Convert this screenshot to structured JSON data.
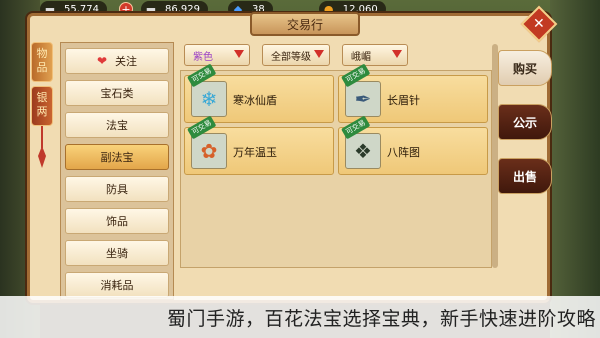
{
  "resources": [
    {
      "icon": "silver-ingot-icon",
      "glyph": "▬",
      "value": "55,774",
      "color": "#d9d9d9"
    },
    {
      "icon": "silver-ingot-icon",
      "glyph": "▬",
      "value": "86,929",
      "color": "#d9d9d9"
    },
    {
      "icon": "diamond-icon",
      "glyph": "◆",
      "value": "38",
      "color": "#4a9cff"
    },
    {
      "icon": "gold-ingot-icon",
      "glyph": "●",
      "value": "12,060",
      "color": "#f0a020"
    }
  ],
  "plus_label": "+",
  "title": "交易行",
  "close_label": "✕",
  "left_tabs": [
    {
      "label": "物品"
    },
    {
      "label": "银两"
    }
  ],
  "categories": [
    {
      "label": "关注"
    },
    {
      "label": "宝石类"
    },
    {
      "label": "法宝"
    },
    {
      "label": "副法宝"
    },
    {
      "label": "防具"
    },
    {
      "label": "饰品"
    },
    {
      "label": "坐骑"
    },
    {
      "label": "消耗品"
    }
  ],
  "filters": {
    "color": "紫色",
    "level": "全部等级",
    "type": "峨嵋"
  },
  "items": [
    {
      "name": "寒冰仙盾",
      "badge": "可交易",
      "icon": "ice-crystal-icon",
      "glyph": "❄"
    },
    {
      "name": "长眉针",
      "badge": "可交易",
      "icon": "needle-icon",
      "glyph": "✒"
    },
    {
      "name": "万年温玉",
      "badge": "可交易",
      "icon": "jade-icon",
      "glyph": "✿"
    },
    {
      "name": "八阵图",
      "badge": "可交易",
      "icon": "formation-icon",
      "glyph": "❖"
    }
  ],
  "right_tabs": [
    {
      "label": "购买"
    },
    {
      "label": "公示"
    },
    {
      "label": "出售"
    }
  ],
  "caption": "蜀门手游，百花法宝选择宝典，新手快速进阶攻略",
  "colors": {
    "frame": "#a06b34",
    "panel": "#f1dcb2",
    "active_category": "#e3a64a",
    "close": "#c23a22"
  }
}
